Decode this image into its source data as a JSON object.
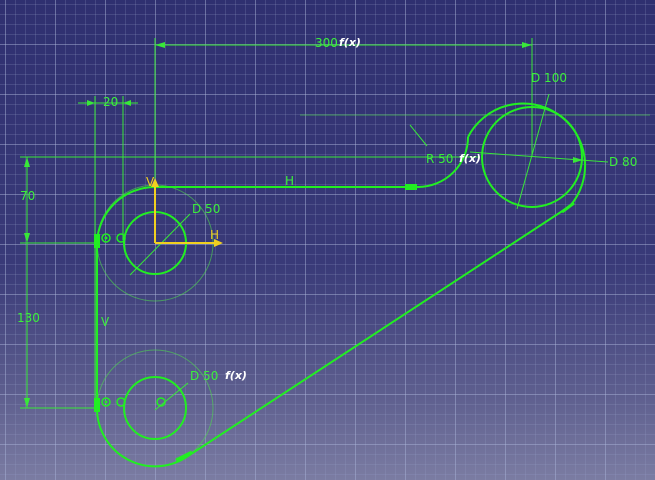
{
  "dimensions": {
    "horizontal_distance": "300",
    "small_offset": "20",
    "vertical_top": "70",
    "vertical_bottom": "130",
    "top_right_outer_diameter": "D 100",
    "top_right_inner_diameter": "D 80",
    "origin_circle_diameter": "D 50",
    "bottom_circle_diameter": "D 50",
    "fillet_radius": "R 50"
  },
  "constraint_labels": {
    "horizontal": "H",
    "vertical": "V"
  },
  "axis_labels": {
    "h_axis": "H",
    "v_axis": "V"
  },
  "formula_tag": "f(x)",
  "colors": {
    "geometry": "#22ee22",
    "axis": "#f0d020",
    "background": "#3b3b78"
  }
}
